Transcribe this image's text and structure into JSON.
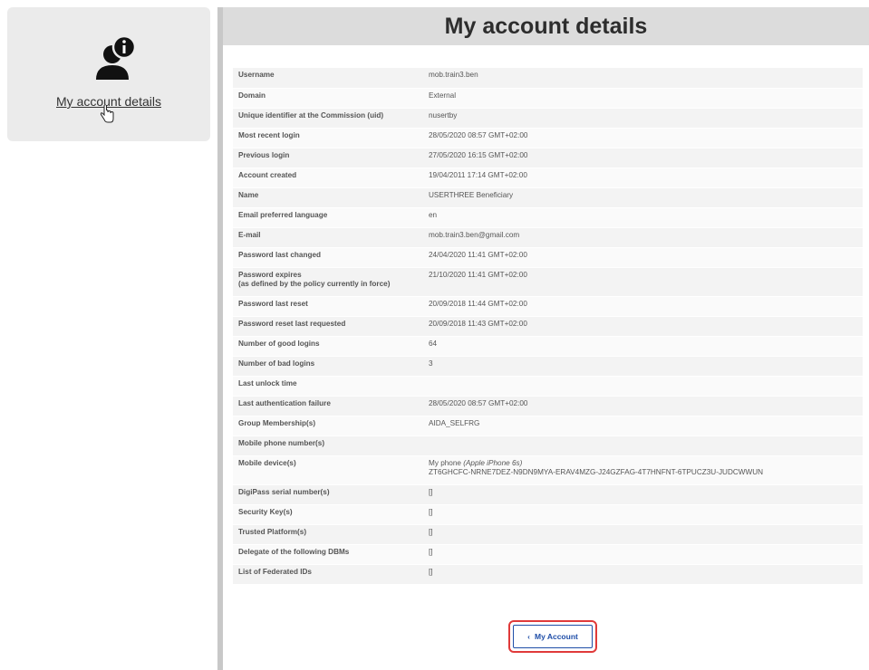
{
  "sidebar": {
    "link_label": "My account details"
  },
  "header": {
    "title": "My account details"
  },
  "details": [
    {
      "label": "Username",
      "value": "mob.train3.ben"
    },
    {
      "label": "Domain",
      "value": "External"
    },
    {
      "label": "Unique identifier at the Commission (uid)",
      "value": "nusertby"
    },
    {
      "label": "Most recent login",
      "value": "28/05/2020 08:57 GMT+02:00"
    },
    {
      "label": "Previous login",
      "value": "27/05/2020 16:15 GMT+02:00"
    },
    {
      "label": "Account created",
      "value": "19/04/2011 17:14 GMT+02:00"
    },
    {
      "label": "Name",
      "value": "USERTHREE Beneficiary"
    },
    {
      "label": "Email preferred language",
      "value": "en"
    },
    {
      "label": "E-mail",
      "value": "mob.train3.ben@gmail.com"
    },
    {
      "label": "Password last changed",
      "value": "24/04/2020 11:41 GMT+02:00"
    },
    {
      "label": "Password expires",
      "label_note": "(as defined by the policy currently in force)",
      "value": "21/10/2020 11:41 GMT+02:00"
    },
    {
      "label": "Password last reset",
      "value": "20/09/2018 11:44 GMT+02:00"
    },
    {
      "label": "Password reset last requested",
      "value": "20/09/2018 11:43 GMT+02:00"
    },
    {
      "label": "Number of good logins",
      "value": "64"
    },
    {
      "label": "Number of bad logins",
      "value": "3"
    },
    {
      "label": "Last unlock time",
      "value": ""
    },
    {
      "label": "Last authentication failure",
      "value": "28/05/2020 08:57 GMT+02:00"
    },
    {
      "label": "Group Membership(s)",
      "value": "AIDA_SELFRG"
    },
    {
      "label": "Mobile phone number(s)",
      "value": ""
    },
    {
      "label": "Mobile device(s)",
      "value_line1_prefix": "My phone ",
      "value_line1_italic": "(Apple iPhone 6s)",
      "value_line2": "ZT6GHCFC-NRNE7DEZ-N9DN9MYA-ERAV4MZG-J24GZFAG-4T7HNFNT-6TPUCZ3U-JUDCWWUN"
    },
    {
      "label": "DigiPass serial number(s)",
      "value": "[]"
    },
    {
      "label": "Security Key(s)",
      "value": "[]"
    },
    {
      "label": "Trusted Platform(s)",
      "value": "[]"
    },
    {
      "label": "Delegate of the following DBMs",
      "value": "[]"
    },
    {
      "label": "List of Federated IDs",
      "value": "[]"
    }
  ],
  "button": {
    "label": "My Account",
    "chevron": "‹"
  },
  "colors": {
    "button_blue": "#1f4ea8",
    "highlight_red": "#e03a3a"
  },
  "icons": [
    "account-info-icon",
    "hand-cursor-icon",
    "chevron-left-icon"
  ]
}
